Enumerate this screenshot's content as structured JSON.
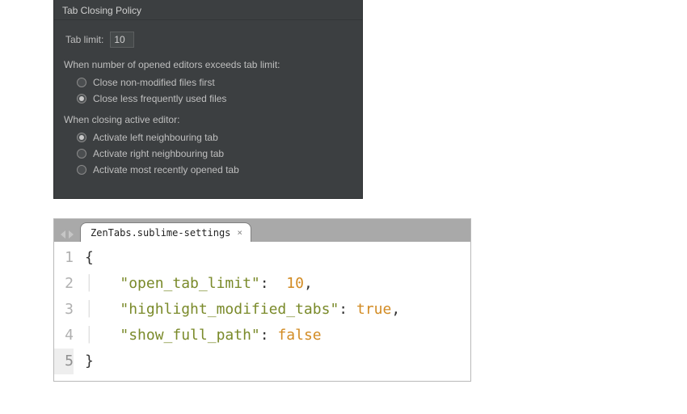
{
  "settings_panel": {
    "title": "Tab Closing Policy",
    "tab_limit_label": "Tab limit:",
    "tab_limit_value": "10",
    "exceed_heading": "When number of opened editors exceeds tab limit:",
    "exceed_options": [
      {
        "label": "Close non-modified files first",
        "selected": false
      },
      {
        "label": "Close less frequently used files",
        "selected": true
      }
    ],
    "closing_heading": "When closing active editor:",
    "closing_options": [
      {
        "label": "Activate left neighbouring tab",
        "selected": true
      },
      {
        "label": "Activate right neighbouring tab",
        "selected": false
      },
      {
        "label": "Activate most recently opened tab",
        "selected": false
      }
    ]
  },
  "editor": {
    "tab_name": "ZenTabs.sublime-settings",
    "gutter": [
      "1",
      "2",
      "3",
      "4",
      "5"
    ],
    "json_lines": {
      "l1_open": "{",
      "l2_key": "\"open_tab_limit\"",
      "l2_val": "10",
      "l3_key": "\"highlight_modified_tabs\"",
      "l3_val": "true",
      "l4_key": "\"show_full_path\"",
      "l4_val": "false",
      "l5_close": "}"
    }
  }
}
